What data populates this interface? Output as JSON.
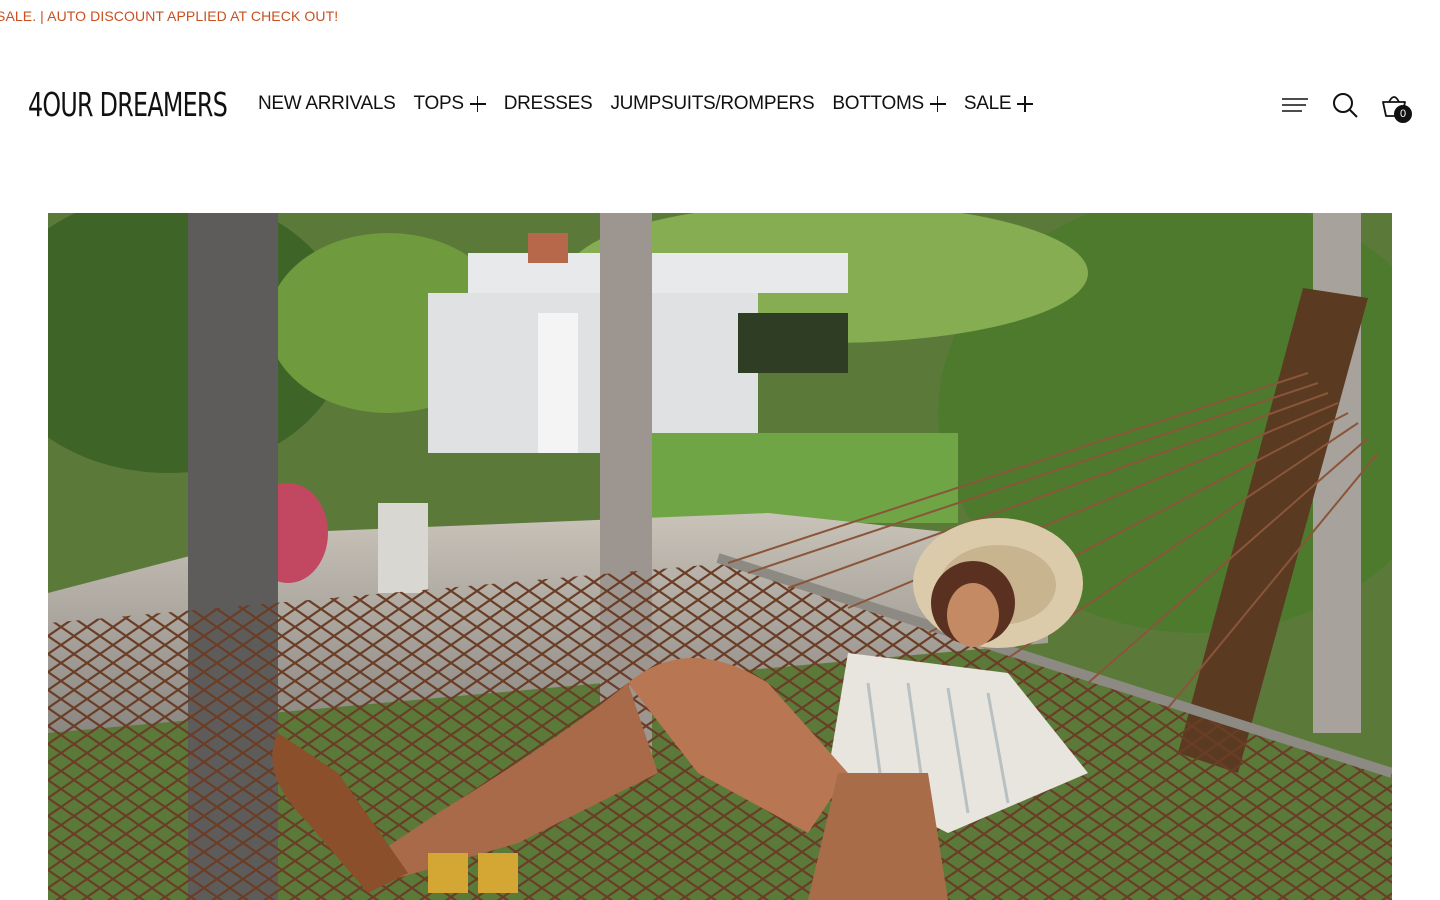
{
  "announcement": {
    "text": "SALE. | AUTO DISCOUNT APPLIED AT CHECK OUT!",
    "color": "#c8501f"
  },
  "header": {
    "logo": "4OUR DREAMERS",
    "nav": [
      {
        "label": "NEW ARRIVALS",
        "has_submenu": false
      },
      {
        "label": "TOPS",
        "has_submenu": true
      },
      {
        "label": "DRESSES",
        "has_submenu": false
      },
      {
        "label": "JUMPSUITS/ROMPERS",
        "has_submenu": false
      },
      {
        "label": "BOTTOMS",
        "has_submenu": true
      },
      {
        "label": "SALE",
        "has_submenu": true
      }
    ],
    "icons": [
      "menu-icon",
      "search-icon",
      "cart-icon"
    ],
    "cart_count": "0"
  },
  "hero": {
    "image": "woman-in-hammock-photo"
  }
}
